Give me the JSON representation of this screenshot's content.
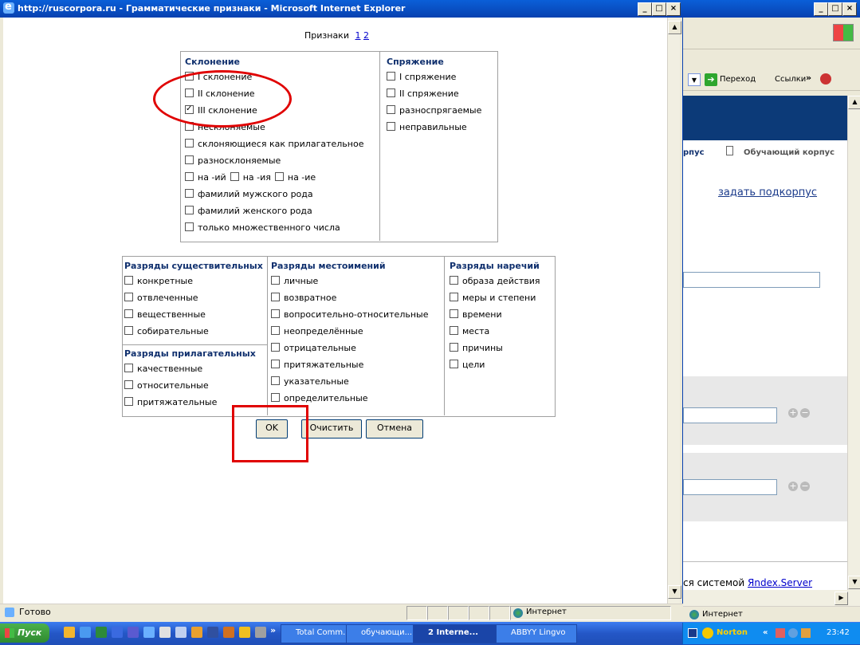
{
  "popup": {
    "title": "http://ruscorpora.ru - Грамматические признаки - Microsoft Internet Explorer",
    "pages_label": "Признаки",
    "page_links": [
      "1",
      "2"
    ]
  },
  "declension": {
    "header": "Склонение",
    "items": [
      {
        "label": "I склонение",
        "checked": false
      },
      {
        "label": "II склонение",
        "checked": false
      },
      {
        "label": "III склонение",
        "checked": true
      },
      {
        "label": "несклоняемые",
        "checked": false
      },
      {
        "label": "склоняющиеся как прилагательное",
        "checked": false
      },
      {
        "label": "разносклоняемые",
        "checked": false
      }
    ],
    "inline_items": [
      "на -ий",
      "на -ия",
      "на -ие"
    ],
    "items2": [
      {
        "label": "фамилий мужского рода",
        "checked": false
      },
      {
        "label": "фамилий женского рода",
        "checked": false
      },
      {
        "label": "только множественного числа",
        "checked": false
      }
    ]
  },
  "conjugation": {
    "header": "Спряжение",
    "items": [
      "I спряжение",
      "II спряжение",
      "разноспрягаемые",
      "неправильные"
    ]
  },
  "noun_classes": {
    "header": "Разряды существительных",
    "items": [
      "конкретные",
      "отвлеченные",
      "вещественные",
      "собирательные"
    ]
  },
  "adj_classes": {
    "header": "Разряды прилагательных",
    "items": [
      "качественные",
      "относительные",
      "притяжательные"
    ]
  },
  "pronoun_classes": {
    "header": "Разряды местоимений",
    "items": [
      "личные",
      "возвратное",
      "вопросительно-относительные",
      "неопределённые",
      "отрицательные",
      "притяжательные",
      "указательные",
      "определительные"
    ]
  },
  "adverb_classes": {
    "header": "Разряды наречий",
    "items": [
      "образа действия",
      "меры и степени",
      "времени",
      "места",
      "причины",
      "цели"
    ]
  },
  "buttons": {
    "ok": "OK",
    "clear": "Очистить",
    "cancel": "Отмена"
  },
  "status": {
    "left": "Готово",
    "zone": "Интернет"
  },
  "back": {
    "go": "Переход",
    "links": "Ссылки",
    "tab_corpus": "рпус",
    "tab_learning": "Обучающий корпус",
    "subcorpus_link": "задать подкорпус",
    "footer_prefix": "ся системой ",
    "footer_link": "Яndex.Server",
    "zone": "Интернет"
  },
  "taskbar": {
    "start": "Пуск",
    "items": [
      "Total Comm...",
      "обучающи...",
      "2 Interne...",
      "ABBYY Lingvo"
    ],
    "tray_norton": "Norton",
    "clock": "23:42"
  },
  "colors": {
    "annotation": "#e00000",
    "title_blue": "#0841b0",
    "header_navy": "#10306e"
  }
}
